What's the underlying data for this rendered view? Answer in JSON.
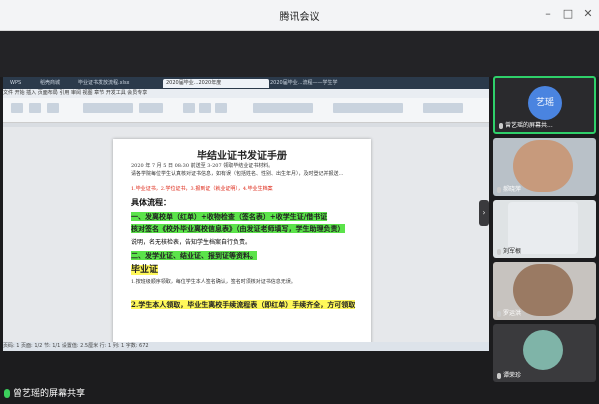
{
  "window": {
    "title": "腾讯会议"
  },
  "share_label": "曾艺瑶的屏幕共享",
  "wps": {
    "tabs": [
      "WPS",
      "稻壳商城",
      "毕业证书发放流程.xlsx",
      "2020届毕业...2020年度",
      "2020届毕业...流程——学生学"
    ],
    "menu": "文件  开始  插入  页面布局  引用  审阅  视图  章节  开发工具  会员专享",
    "status": "页码: 1  页面: 1/2  节: 1/1  设置值: 2.5厘米  行: 1  列: 1  字数: 672"
  },
  "doc": {
    "title": "毕结业证书发证手册",
    "intro": "2020 年 7 月 5 日 08:30 前送至 3-207 领取毕结业证书材料。",
    "body1": "请各学院每位学生认真核对证书信息，如有误（包括姓名、性别、出生年月），及时登记并报送…",
    "notice_red": "1.毕业证书，2.学位证书，3.报到证（就业证明），4.毕业生档案",
    "section_heading": "具体流程：",
    "step1": "一、发离校单（红单）+收物检查（签名表）+收学生证/借书证",
    "step1b": "核对签名《校外毕业离校信息表》（由发证老师填写，学生助理负责）",
    "note": "说明，名无核检表，告知学生档案自行负责。",
    "step2": "二、发学业证、结业证、报到证等资料。",
    "section2": "毕业证",
    "body2": "1.按班级顺序领取，每位学生本人签名确认，签名时须核对证书信息无误。",
    "step3": "2.学生本人领取，毕业生离校手续流程表（即红单）手续齐全，方可领取"
  },
  "participants": [
    {
      "name": "艺瑶",
      "label": "曾艺瑶的屏幕共...",
      "speaking": true
    },
    {
      "name": "",
      "label": "郝晓萍",
      "speaking": false
    },
    {
      "name": "",
      "label": "刘军根",
      "speaking": false
    },
    {
      "name": "",
      "label": "罗运洪",
      "speaking": false
    },
    {
      "name": "",
      "label": "谭荣珍",
      "speaking": false
    }
  ],
  "colors": {
    "accent_green": "#2fd06a",
    "avatar_blue": "#4a84e0",
    "highlight_green": "#5be34a",
    "highlight_yellow": "#fff85a"
  }
}
